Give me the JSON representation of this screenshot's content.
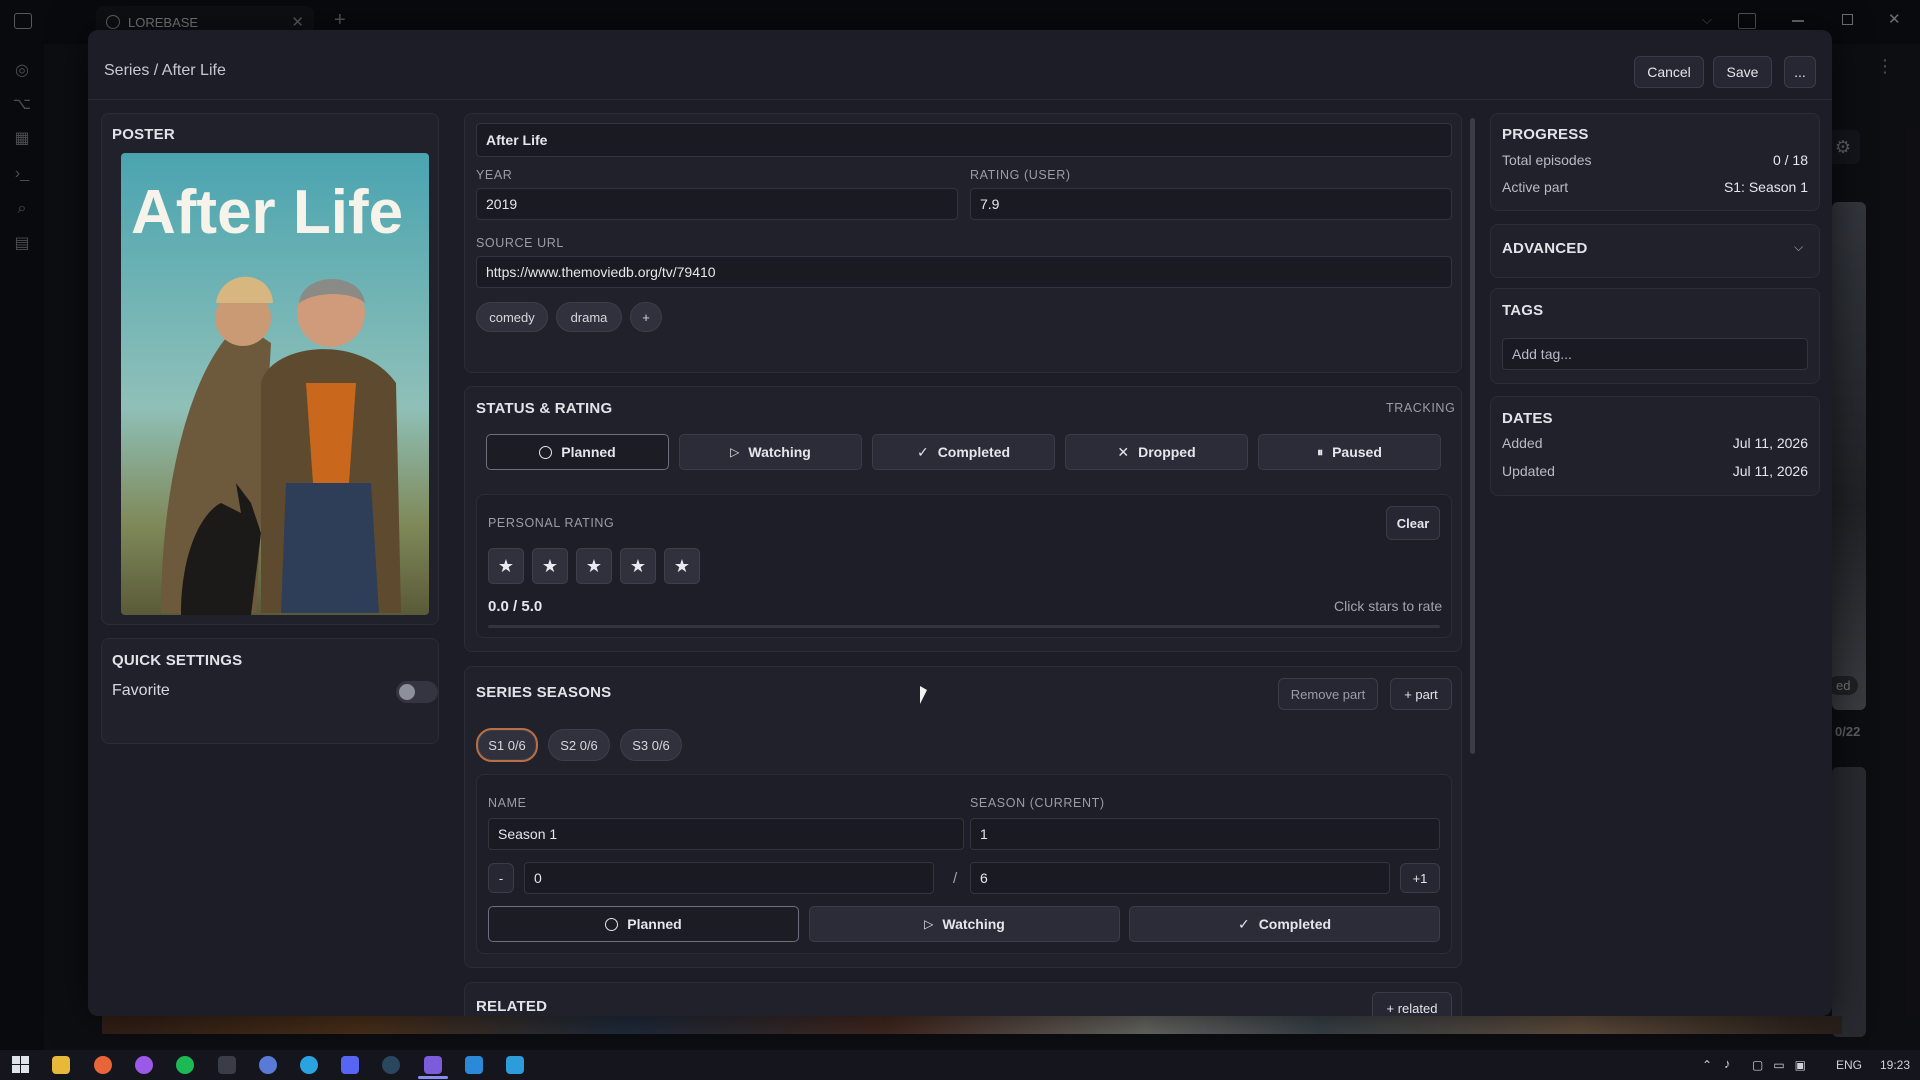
{
  "browser": {
    "tab_title": "LOREBASE",
    "new_tab": "+"
  },
  "modal": {
    "breadcrumb": "Series / After Life",
    "cancel": "Cancel",
    "save": "Save",
    "more": "..."
  },
  "poster": {
    "heading": "POSTER",
    "title_text": "After Life"
  },
  "quick_settings": {
    "heading": "QUICK SETTINGS",
    "favorite_label": "Favorite",
    "favorite_on": false
  },
  "details": {
    "title": "After Life",
    "year_label": "YEAR",
    "year": "2019",
    "rating_label": "RATING (USER)",
    "rating": "7.9",
    "source_label": "SOURCE URL",
    "source_url": "https://www.themoviedb.org/tv/79410",
    "tags": [
      "comedy",
      "drama"
    ],
    "add_tag": "+"
  },
  "status": {
    "heading": "STATUS & RATING",
    "tracking": "TRACKING",
    "buttons": [
      "Planned",
      "Watching",
      "Completed",
      "Dropped",
      "Paused"
    ],
    "active": "Planned",
    "personal_rating_label": "PERSONAL RATING",
    "clear": "Clear",
    "stars_filled": 0,
    "stars_total": 5,
    "score": "0.0 / 5.0",
    "hint": "Click stars to rate"
  },
  "seasons": {
    "heading": "SERIES SEASONS",
    "remove_part": "Remove part",
    "add_part": "+ part",
    "chips": [
      "S1 0/6",
      "S2 0/6",
      "S3 0/6"
    ],
    "active_chip": "S1 0/6",
    "name_label": "NAME",
    "name": "Season 1",
    "season_label": "SEASON (CURRENT)",
    "season": "1",
    "minus": "-",
    "watched": "0",
    "slash": "/",
    "total": "6",
    "plus": "+1",
    "buttons": [
      "Planned",
      "Watching",
      "Completed"
    ]
  },
  "related": {
    "heading": "RELATED",
    "add": "+ related"
  },
  "progress": {
    "heading": "PROGRESS",
    "total_label": "Total episodes",
    "total_value": "0 / 18",
    "active_label": "Active part",
    "active_value": "S1: Season 1"
  },
  "advanced": {
    "heading": "ADVANCED"
  },
  "tags": {
    "heading": "TAGS",
    "placeholder": "Add tag..."
  },
  "dates": {
    "heading": "DATES",
    "added_label": "Added",
    "added_value": "Jul 11, 2026",
    "updated_label": "Updated",
    "updated_value": "Jul 11, 2026"
  },
  "background": {
    "card_label": "ed",
    "card_count": "0/22"
  },
  "taskbar": {
    "language": "ENG",
    "time": "19:23"
  }
}
